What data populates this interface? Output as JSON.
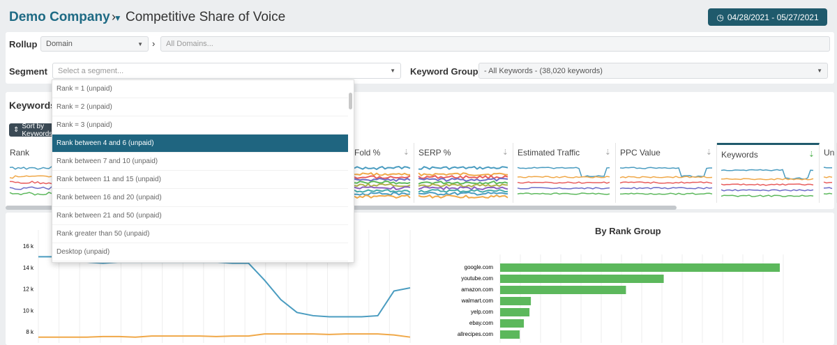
{
  "header": {
    "company": "Demo Company",
    "separator": "›",
    "page_title": "Competitive Share of Voice",
    "date_range": "04/28/2021 - 05/27/2021"
  },
  "filters": {
    "rollup_label": "Rollup",
    "rollup_value": "Domain",
    "domains_placeholder": "All Domains...",
    "segment_label": "Segment",
    "segment_placeholder": "Select a segment...",
    "keyword_group_label": "Keyword Group",
    "keyword_group_value": "- All Keywords - (38,020 keywords)"
  },
  "segment_options": [
    "Rank = 1 (unpaid)",
    "Rank = 2 (unpaid)",
    "Rank = 3 (unpaid)",
    "Rank between 4 and 6 (unpaid)",
    "Rank between 7 and 10 (unpaid)",
    "Rank between 11 and 15 (unpaid)",
    "Rank between 16 and 20 (unpaid)",
    "Rank between 21 and 50 (unpaid)",
    "Rank greater than 50 (unpaid)",
    "Desktop (unpaid)"
  ],
  "selected_option_index": 3,
  "keywords_card": {
    "title": "Keywords",
    "sort_label": "Sort by Keywords",
    "columns": [
      "Rank",
      "Fold %",
      "SERP %",
      "Estimated Traffic",
      "PPC Value",
      "Keywords",
      "Un"
    ],
    "active_column": "Keywords"
  },
  "colors": {
    "accent": "#1f5a6c",
    "bar": "#5cb85c",
    "blue": "#4a9cc0",
    "orange": "#f0a848"
  },
  "chart_data": [
    {
      "type": "line",
      "title": "",
      "y_ticks": [
        "16 k",
        "14 k",
        "12 k",
        "10 k",
        "8 k"
      ],
      "ylim": [
        7000,
        16500
      ],
      "series": [
        {
          "name": "blue",
          "values": [
            15000,
            15000,
            14900,
            14500,
            14400,
            14500,
            14500,
            14500,
            14500,
            14500,
            14500,
            14500,
            14400,
            14400,
            12800,
            11000,
            9800,
            9500,
            9400,
            9400,
            9400,
            9500,
            11800,
            12100
          ]
        },
        {
          "name": "orange",
          "values": [
            7500,
            7500,
            7500,
            7500,
            7550,
            7550,
            7500,
            7600,
            7600,
            7600,
            7600,
            7550,
            7600,
            7600,
            7800,
            7800,
            7800,
            7800,
            7750,
            7800,
            7800,
            7800,
            7700,
            7500
          ]
        }
      ]
    },
    {
      "type": "bar",
      "title": "By Rank Group",
      "categories": [
        "google.com",
        "youtube.com",
        "amazon.com",
        "walmart.com",
        "yelp.com",
        "ebay.com",
        "allrecipes.com"
      ],
      "values": [
        100,
        58.5,
        45,
        11,
        10.5,
        8.5,
        7
      ]
    }
  ]
}
